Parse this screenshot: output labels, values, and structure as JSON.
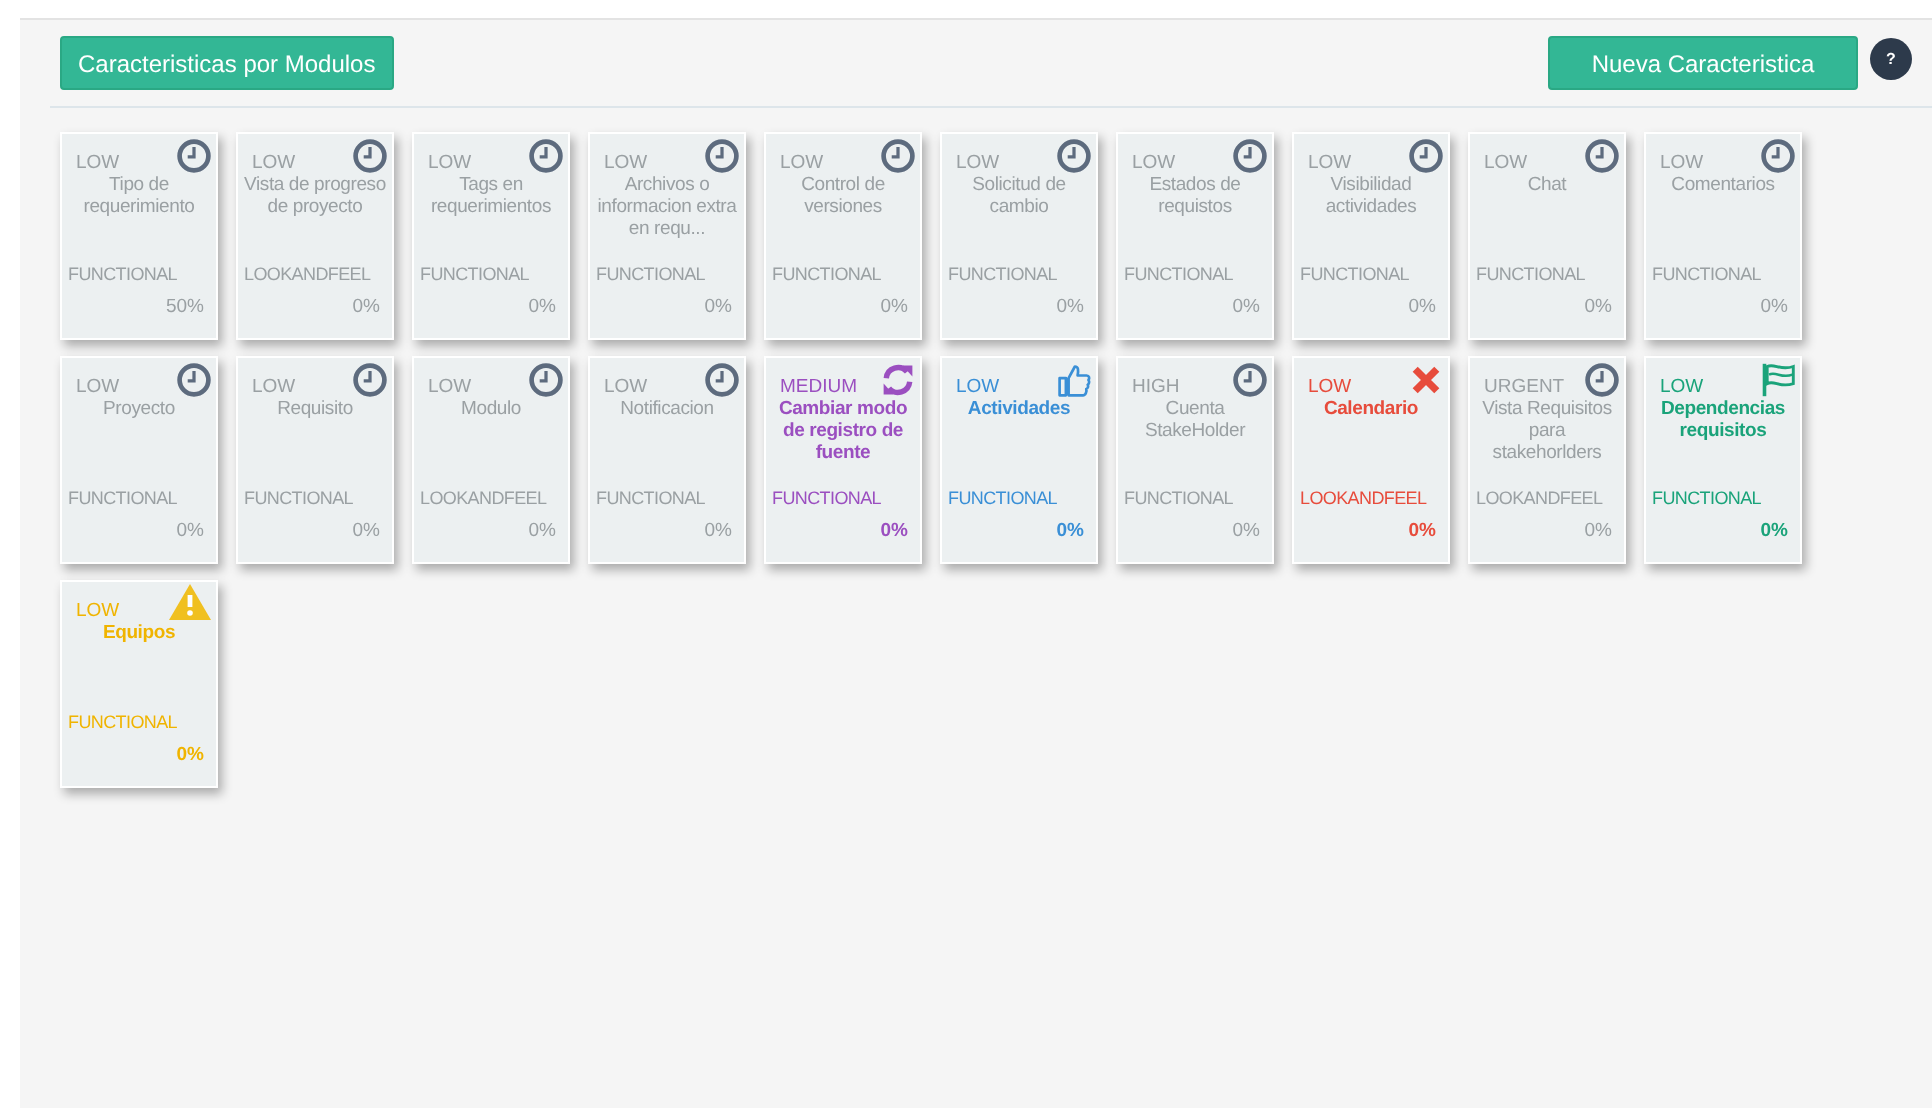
{
  "header": {
    "modules_button": "Caracteristicas por Modulos",
    "new_button": "Nueva Caracteristica",
    "help_label": "?"
  },
  "cards": [
    {
      "priority": "LOW",
      "title": "Tipo de requerimiento",
      "type": "FUNCTIONAL",
      "progress": "50%",
      "kind": "pending"
    },
    {
      "priority": "LOW",
      "title": "Vista de progreso de proyecto",
      "type": "LOOKANDFEEL",
      "progress": "0%",
      "kind": "pending"
    },
    {
      "priority": "LOW",
      "title": "Tags en requerimientos",
      "type": "FUNCTIONAL",
      "progress": "0%",
      "kind": "pending"
    },
    {
      "priority": "LOW",
      "title": "Archivos o informacion extra en requ...",
      "type": "FUNCTIONAL",
      "progress": "0%",
      "kind": "pending"
    },
    {
      "priority": "LOW",
      "title": "Control de versiones",
      "type": "FUNCTIONAL",
      "progress": "0%",
      "kind": "pending"
    },
    {
      "priority": "LOW",
      "title": "Solicitud de cambio",
      "type": "FUNCTIONAL",
      "progress": "0%",
      "kind": "pending"
    },
    {
      "priority": "LOW",
      "title": "Estados de requistos",
      "type": "FUNCTIONAL",
      "progress": "0%",
      "kind": "pending"
    },
    {
      "priority": "LOW",
      "title": "Visibilidad actividades",
      "type": "FUNCTIONAL",
      "progress": "0%",
      "kind": "pending"
    },
    {
      "priority": "LOW",
      "title": "Chat",
      "type": "FUNCTIONAL",
      "progress": "0%",
      "kind": "pending"
    },
    {
      "priority": "LOW",
      "title": "Comentarios",
      "type": "FUNCTIONAL",
      "progress": "0%",
      "kind": "pending"
    },
    {
      "priority": "LOW",
      "title": "Proyecto",
      "type": "FUNCTIONAL",
      "progress": "0%",
      "kind": "pending"
    },
    {
      "priority": "LOW",
      "title": "Requisito",
      "type": "FUNCTIONAL",
      "progress": "0%",
      "kind": "pending"
    },
    {
      "priority": "LOW",
      "title": "Modulo",
      "type": "LOOKANDFEEL",
      "progress": "0%",
      "kind": "pending"
    },
    {
      "priority": "LOW",
      "title": "Notificacion",
      "type": "FUNCTIONAL",
      "progress": "0%",
      "kind": "pending"
    },
    {
      "priority": "MEDIUM",
      "title": "Cambiar modo de registro de fuente",
      "type": "FUNCTIONAL",
      "progress": "0%",
      "kind": "in_progress"
    },
    {
      "priority": "LOW",
      "title": "Actividades",
      "type": "FUNCTIONAL",
      "progress": "0%",
      "kind": "approved"
    },
    {
      "priority": "HIGH",
      "title": "Cuenta StakeHolder",
      "type": "FUNCTIONAL",
      "progress": "0%",
      "kind": "pending"
    },
    {
      "priority": "LOW",
      "title": "Calendario",
      "type": "LOOKANDFEEL",
      "progress": "0%",
      "kind": "rejected"
    },
    {
      "priority": "URGENT",
      "title": "Vista Requisitos para stakehorlders",
      "type": "LOOKANDFEEL",
      "progress": "0%",
      "kind": "pending"
    },
    {
      "priority": "LOW",
      "title": "Dependencias requisitos",
      "type": "FUNCTIONAL",
      "progress": "0%",
      "kind": "done"
    },
    {
      "priority": "LOW",
      "title": "Equipos",
      "type": "FUNCTIONAL",
      "progress": "0%",
      "kind": "warning"
    }
  ]
}
